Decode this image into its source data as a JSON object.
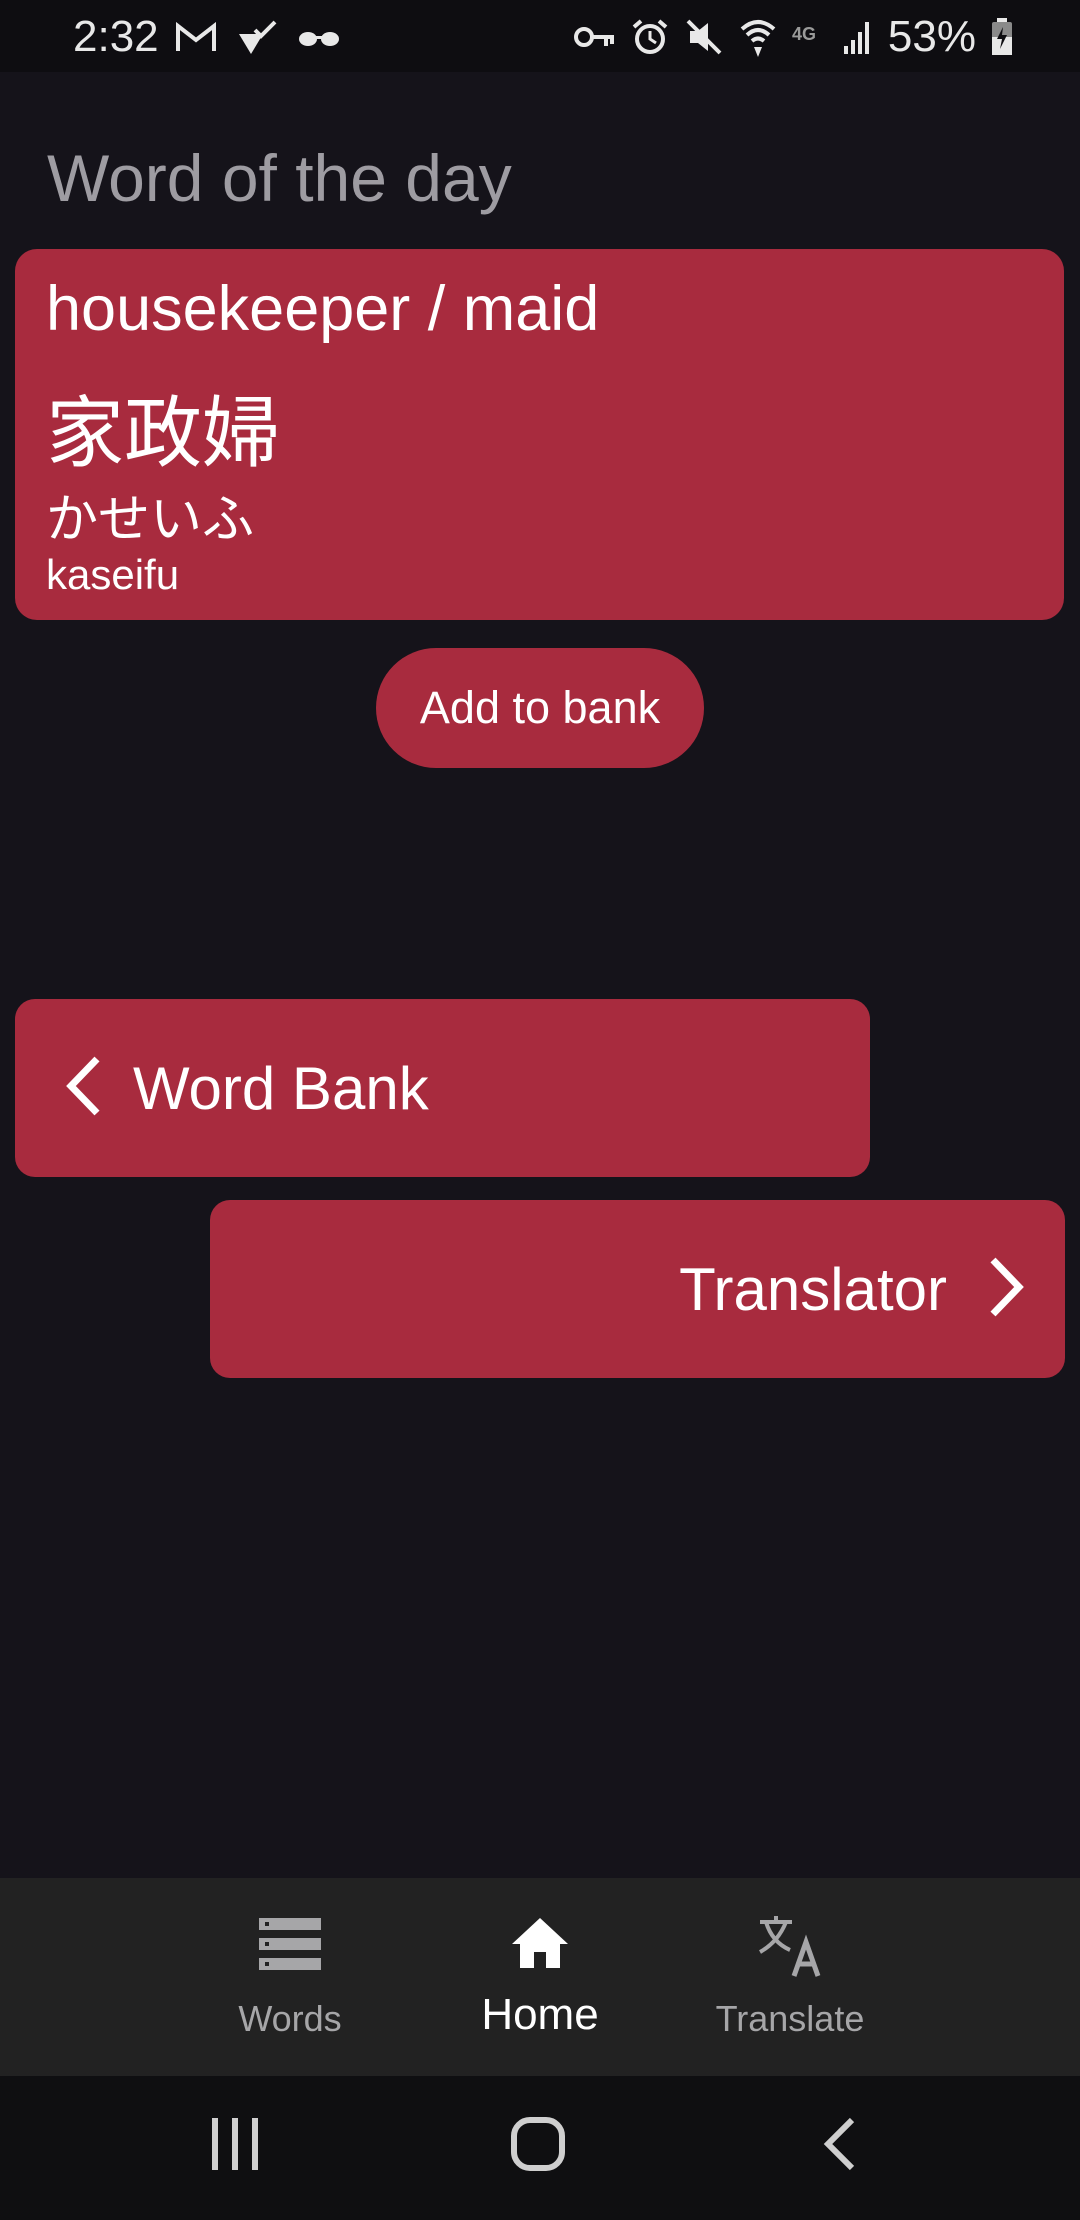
{
  "status_bar": {
    "time": "2:32",
    "battery": "53%",
    "left_icons": [
      "gmail-icon",
      "location-check-icon",
      "incognito-icon"
    ],
    "right_icons": [
      "vpn-key-icon",
      "alarm-icon",
      "mute-icon",
      "wifi-icon",
      "4g-icon",
      "signal-icon",
      "battery-icon"
    ]
  },
  "page": {
    "title": "Word of the day"
  },
  "word_card": {
    "english": "housekeeper / maid",
    "kanji": "家政婦",
    "kana": "かせいふ",
    "romaji": "kaseifu"
  },
  "actions": {
    "add_to_bank": "Add to bank"
  },
  "nav_cards": {
    "word_bank": "Word Bank",
    "translator": "Translator"
  },
  "bottom_nav": {
    "items": [
      {
        "label": "Words",
        "icon": "list-icon",
        "active": false
      },
      {
        "label": "Home",
        "icon": "home-icon",
        "active": true
      },
      {
        "label": "Translate",
        "icon": "translate-icon",
        "active": false
      }
    ]
  },
  "colors": {
    "background": "#15131a",
    "accent": "#a82b3e",
    "nav_bar": "#222222"
  }
}
